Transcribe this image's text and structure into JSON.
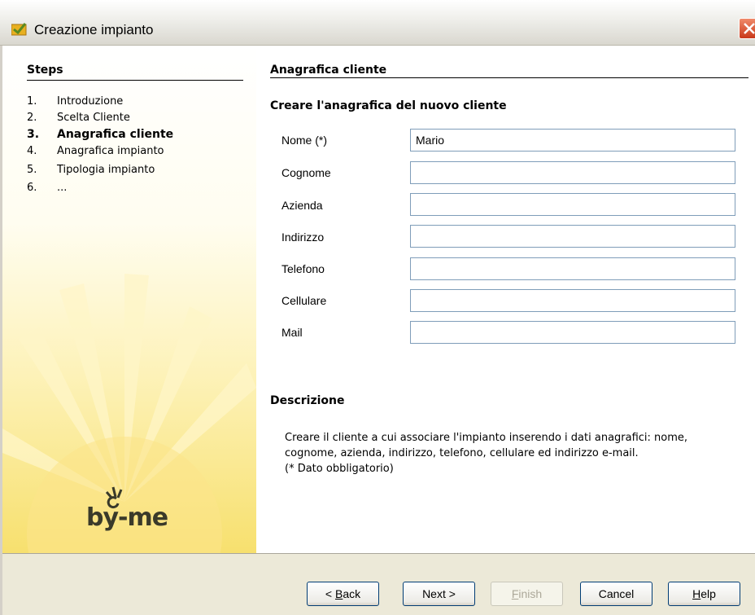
{
  "window": {
    "title": "Creazione impianto",
    "accent": "#d8a020",
    "close_icon": "close-icon"
  },
  "sidebar": {
    "heading": "Steps",
    "steps": [
      {
        "num": "1.",
        "label": "Introduzione",
        "active": false
      },
      {
        "num": "2.",
        "label": "Scelta Cliente",
        "active": false
      },
      {
        "num": "3.",
        "label": "Anagrafica cliente",
        "active": true
      },
      {
        "num": "4.",
        "label": "Anagrafica impianto",
        "active": false
      },
      {
        "num": "5.",
        "label": "Tipologia impianto",
        "active": false
      },
      {
        "num": "6.",
        "label": "...",
        "active": false
      }
    ],
    "logo_text": "by-me"
  },
  "main": {
    "section_title": "Anagrafica cliente",
    "form_title": "Creare l'anagrafica del nuovo cliente",
    "fields": [
      {
        "label": "Nome (*)",
        "value": "Mario"
      },
      {
        "label": "Cognome",
        "value": ""
      },
      {
        "label": "Azienda",
        "value": ""
      },
      {
        "label": "Indirizzo",
        "value": ""
      },
      {
        "label": "Telefono",
        "value": ""
      },
      {
        "label": "Cellulare",
        "value": ""
      },
      {
        "label": "Mail",
        "value": ""
      }
    ],
    "description_title": "Descrizione",
    "description_lines": [
      "Creare il cliente a cui associare l'impianto inserendo i dati anagrafici: nome,",
      "cognome, azienda, indirizzo, telefono, cellulare ed indirizzo e-mail.",
      "(* Dato obbligatorio)"
    ]
  },
  "buttons": {
    "back_prefix": "< ",
    "back_mnemonic": "B",
    "back_rest": "ack",
    "next": "Next >",
    "finish_mnemonic": "F",
    "finish_rest": "inish",
    "cancel": "Cancel",
    "help_mnemonic": "H",
    "help_rest": "elp"
  }
}
